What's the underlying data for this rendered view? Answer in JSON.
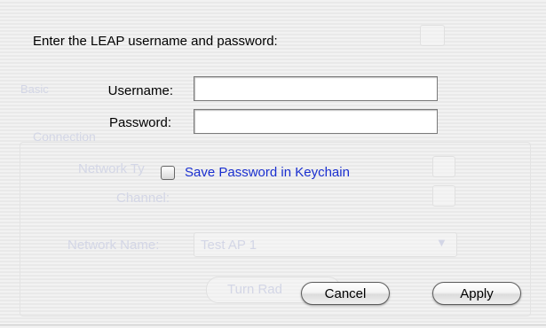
{
  "background": {
    "tab_label": "Basic",
    "group_title": "Connection",
    "network_type_label": "Network Ty",
    "channel_label": "Channel:",
    "network_name_label": "Network Name:",
    "network_name_value": "Test AP 1",
    "turn_radio_label": "Turn Rad"
  },
  "dialog": {
    "prompt": "Enter the LEAP username and password:",
    "username_label": "Username:",
    "username_value": "",
    "password_label": "Password:",
    "password_value": "",
    "save_password_label": "Save Password in  Keychain",
    "save_password_checked": false,
    "cancel_label": "Cancel",
    "apply_label": "Apply"
  },
  "colors": {
    "checkbox_label": "#1a2fd0",
    "ghost_text": "#d3d6e6"
  }
}
